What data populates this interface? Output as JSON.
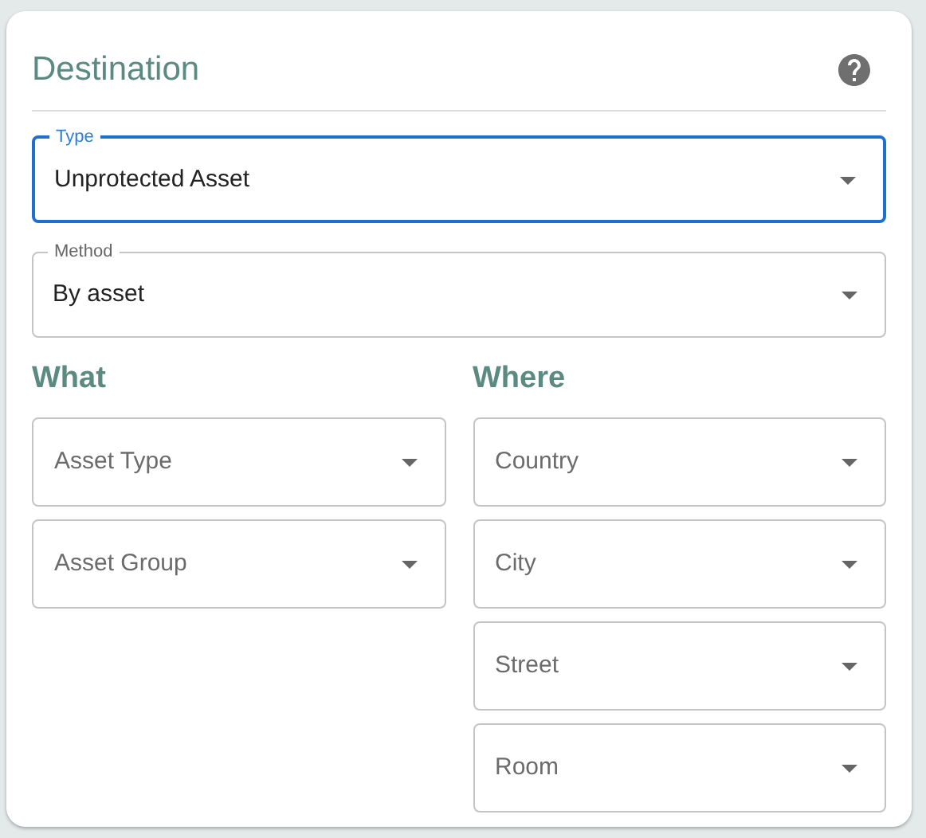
{
  "title": "Destination",
  "type": {
    "label": "Type",
    "value": "Unprotected Asset",
    "focused": true
  },
  "method": {
    "label": "Method",
    "value": "By asset",
    "focused": false
  },
  "what": {
    "heading": "What",
    "fields": [
      {
        "placeholder": "Asset Type"
      },
      {
        "placeholder": "Asset Group"
      }
    ]
  },
  "where": {
    "heading": "Where",
    "fields": [
      {
        "placeholder": "Country"
      },
      {
        "placeholder": "City"
      },
      {
        "placeholder": "Street"
      },
      {
        "placeholder": "Room"
      }
    ]
  }
}
